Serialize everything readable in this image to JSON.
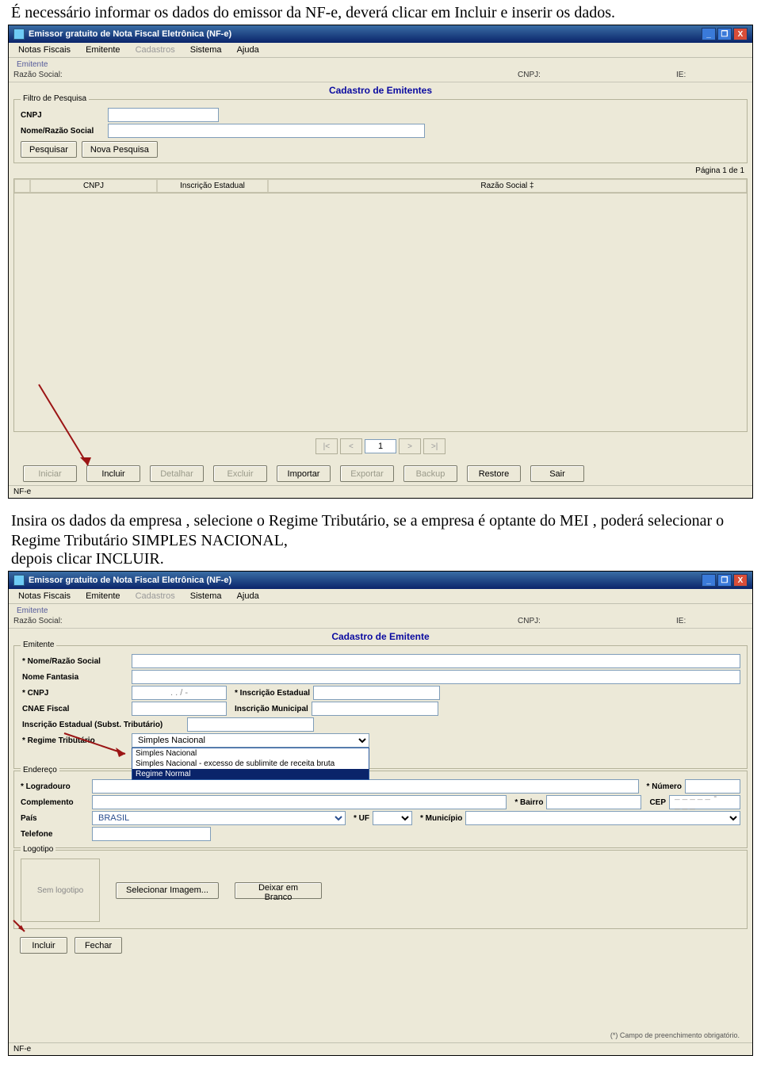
{
  "doc": {
    "para1": "É necessário informar os dados do emissor da NF-e, deverá clicar em Incluir e inserir os dados.",
    "para2": "Insira os dados da empresa , selecione o Regime Tributário, se a empresa é optante do MEI , poderá selecionar o Regime Tributário SIMPLES NACIONAL,",
    "para3": "depois clicar INCLUIR."
  },
  "win1": {
    "title": "Emissor gratuito de Nota Fiscal Eletrônica (NF-e)",
    "menu": [
      "Notas Fiscais",
      "Emitente",
      "Cadastros",
      "Sistema",
      "Ajuda"
    ],
    "menu_disabled_index": 2,
    "emitente_hdr": "Emitente",
    "razao_lbl": "Razão Social:",
    "cnpj_lbl": "CNPJ:",
    "ie_lbl": "IE:",
    "center": "Cadastro de Emitentes",
    "filter": {
      "legend": "Filtro de Pesquisa",
      "cnpj": "CNPJ",
      "nome": "Nome/Razão Social",
      "pesquisar": "Pesquisar",
      "nova": "Nova Pesquisa"
    },
    "page_ind": "Página 1 de 1",
    "cols": {
      "c1": "CNPJ",
      "c2": "Inscrição Estadual",
      "c3": "Razão Social ‡"
    },
    "nav": {
      "first": "|<",
      "prev": "<",
      "page": "1",
      "next": ">",
      "last": ">|"
    },
    "buttons": [
      "Iniciar",
      "Incluir",
      "Detalhar",
      "Excluir",
      "Importar",
      "Exportar",
      "Backup",
      "Restore",
      "Sair"
    ],
    "buttons_enabled": [
      false,
      true,
      false,
      false,
      true,
      false,
      false,
      true,
      true
    ],
    "status": "NF-e"
  },
  "win2": {
    "title": "Emissor gratuito de Nota Fiscal Eletrônica (NF-e)",
    "menu": [
      "Notas Fiscais",
      "Emitente",
      "Cadastros",
      "Sistema",
      "Ajuda"
    ],
    "menu_disabled_index": 2,
    "emitente_hdr": "Emitente",
    "razao_lbl": "Razão Social:",
    "cnpj_lbl": "CNPJ:",
    "ie_lbl": "IE:",
    "center": "Cadastro de Emitente",
    "emitente_legend": "Emitente",
    "fields": {
      "nome": "* Nome/Razão Social",
      "fantasia": "Nome Fantasia",
      "cnpj": "* CNPJ",
      "cnpj_mask": ". . / -",
      "insc_est": "* Inscrição Estadual",
      "cnae": "CNAE Fiscal",
      "insc_mun": "Inscrição Municipal",
      "insc_est_st": "Inscrição Estadual (Subst. Tributário)",
      "regime": "* Regime Tributário"
    },
    "regime": {
      "selected": "Simples Nacional",
      "options": [
        "Simples Nacional",
        "Simples Nacional - excesso de sublimite de receita bruta",
        "Regime Normal"
      ],
      "highlight_index": 2
    },
    "endereco": {
      "legend": "Endereço",
      "lograd": "* Logradouro",
      "numero": "* Número",
      "compl": "Complemento",
      "bairro": "* Bairro",
      "cep": "CEP",
      "cep_mask": "_____-___",
      "pais": "País",
      "pais_val": "BRASIL",
      "uf": "* UF",
      "mun": "* Município",
      "tel": "Telefone"
    },
    "logo": {
      "legend": "Logotipo",
      "placeholder": "Sem logotipo",
      "sel_btn": "Selecionar Imagem...",
      "blank_btn": "Deixar em Branco"
    },
    "bottom": {
      "incluir": "Incluir",
      "fechar": "Fechar"
    },
    "req_note": "(*) Campo de preenchimento obrigatório.",
    "status": "NF-e"
  }
}
